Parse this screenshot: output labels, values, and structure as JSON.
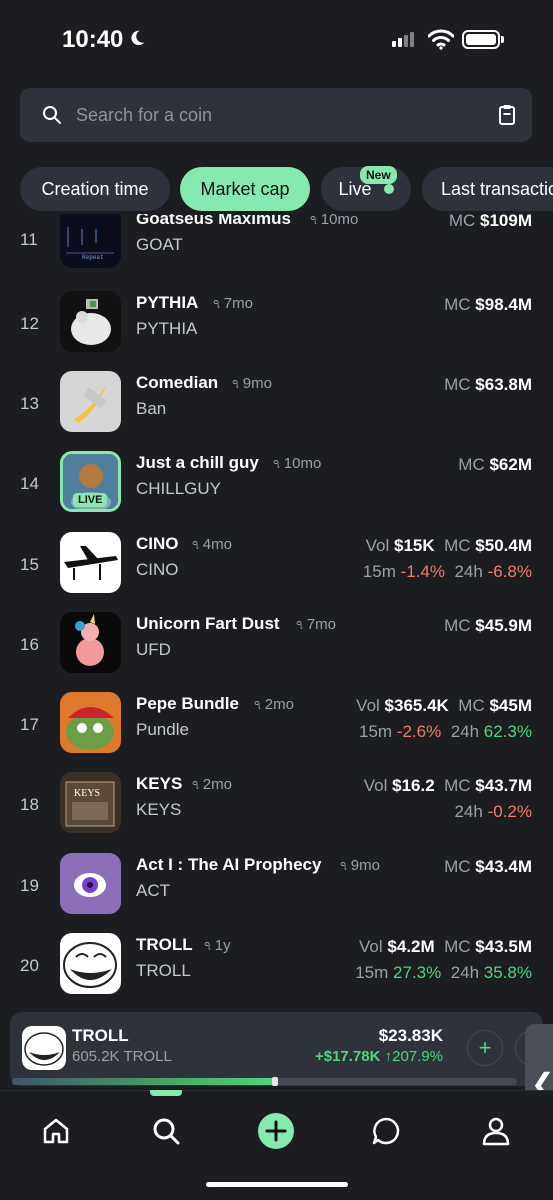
{
  "status_bar": {
    "time": "10:40"
  },
  "search": {
    "placeholder": "Search for a coin"
  },
  "filters": [
    {
      "label": "Creation time",
      "active": false
    },
    {
      "label": "Market cap",
      "active": true
    },
    {
      "label": "Live",
      "active": false,
      "badge": "New"
    },
    {
      "label": "Last transaction",
      "active": false
    }
  ],
  "coins": [
    {
      "rank": "11",
      "name": "Goatseus Maximus",
      "age": "10mo",
      "ticker": "GOAT",
      "vol": null,
      "mc": "$109M",
      "m15": null,
      "h24": null
    },
    {
      "rank": "12",
      "name": "PYTHIA",
      "age": "7mo",
      "ticker": "PYTHIA",
      "vol": null,
      "mc": "$98.4M",
      "m15": null,
      "h24": null
    },
    {
      "rank": "13",
      "name": "Comedian",
      "age": "9mo",
      "ticker": "Ban",
      "vol": null,
      "mc": "$63.8M",
      "m15": null,
      "h24": null
    },
    {
      "rank": "14",
      "name": "Just a chill guy",
      "age": "10mo",
      "ticker": "CHILLGUY",
      "vol": null,
      "mc": "$62M",
      "m15": null,
      "h24": null,
      "live": "LIVE"
    },
    {
      "rank": "15",
      "name": "CINO",
      "age": "4mo",
      "ticker": "CINO",
      "vol": "$15K",
      "mc": "$50.4M",
      "m15": "-1.4%",
      "h24": "-6.8%"
    },
    {
      "rank": "16",
      "name": "Unicorn Fart Dust",
      "age": "7mo",
      "ticker": "UFD",
      "vol": null,
      "mc": "$45.9M",
      "m15": null,
      "h24": null
    },
    {
      "rank": "17",
      "name": "Pepe Bundle",
      "age": "2mo",
      "ticker": "Pundle",
      "vol": "$365.4K",
      "mc": "$45M",
      "m15": "-2.6%",
      "h24": "62.3%"
    },
    {
      "rank": "18",
      "name": "KEYS",
      "age": "2mo",
      "ticker": "KEYS",
      "vol": "$16.2",
      "mc": "$43.7M",
      "m15": null,
      "h24": "-0.2%"
    },
    {
      "rank": "19",
      "name": "Act I : The AI Prophecy",
      "age": "9mo",
      "ticker": "ACT",
      "vol": null,
      "mc": "$43.4M",
      "m15": null,
      "h24": null
    },
    {
      "rank": "20",
      "name": "TROLL",
      "age": "1y",
      "ticker": "TROLL",
      "vol": "$4.2M",
      "mc": "$43.5M",
      "m15": "27.3%",
      "h24": "35.8%"
    }
  ],
  "labels": {
    "vol": "Vol",
    "mc": "MC",
    "m15": "15m",
    "h24": "24h"
  },
  "holding": {
    "name": "TROLL",
    "quantity": "605.2K TROLL",
    "value": "$23.83K",
    "pnl": "+$17.78K",
    "pnl_pct": "↑207.9%",
    "progress": 0.52,
    "buy_symbol": "+",
    "sell_symbol": "−"
  },
  "side_handle": "❮",
  "keys_label": "KEYS",
  "repeat_label": "Repeat",
  "tabs": [
    "home-icon",
    "search-icon",
    "create-icon",
    "chat-icon",
    "profile-icon"
  ],
  "colors": {
    "accent": "#86eab0",
    "positive": "#4fd67f",
    "negative": "#f07b6d",
    "background": "#1c1d21",
    "surface": "#2e333b"
  }
}
